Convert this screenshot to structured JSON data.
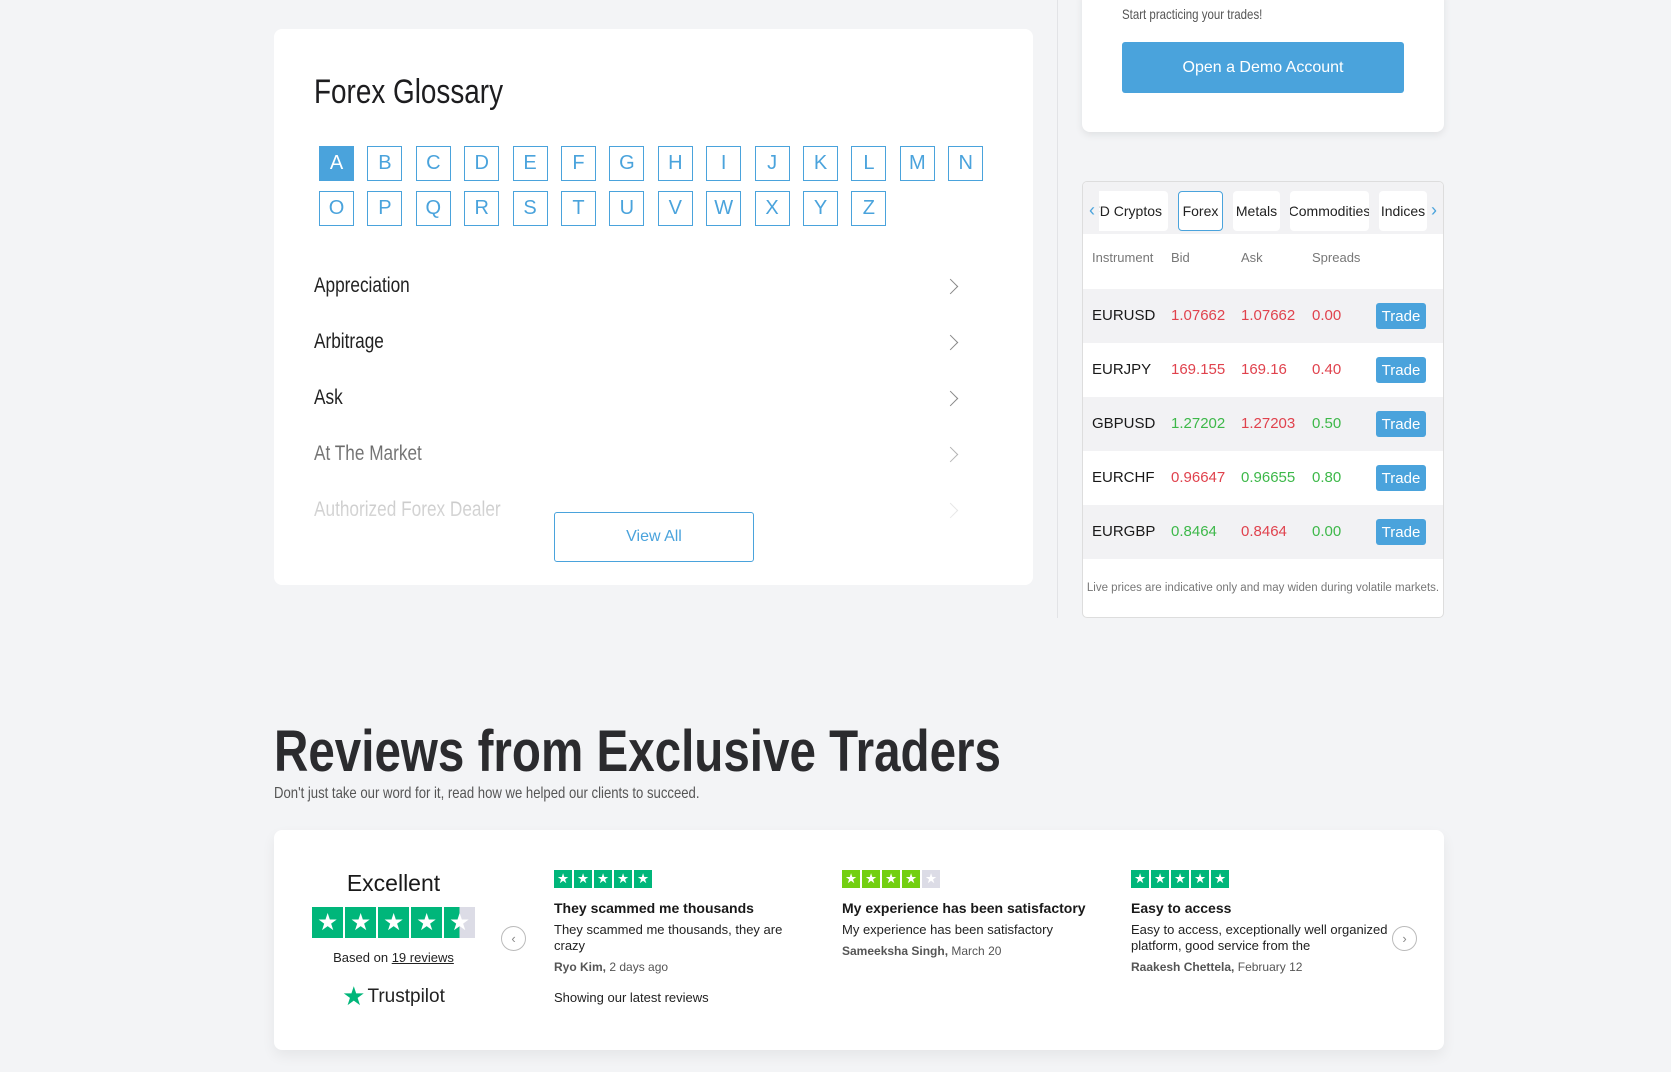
{
  "glossary": {
    "title": "Forex Glossary",
    "letters": [
      "A",
      "B",
      "C",
      "D",
      "E",
      "F",
      "G",
      "H",
      "I",
      "J",
      "K",
      "L",
      "M",
      "N",
      "O",
      "P",
      "Q",
      "R",
      "S",
      "T",
      "U",
      "V",
      "W",
      "X",
      "Y",
      "Z"
    ],
    "active_letter": "A",
    "terms": [
      "Appreciation",
      "Arbitrage",
      "Ask",
      "At The Market",
      "Authorized Forex Dealer"
    ],
    "view_all": "View All"
  },
  "demo": {
    "text": "Start practicing your trades!",
    "button": "Open a Demo Account"
  },
  "market": {
    "tabs": [
      "CFD Cryptos",
      "Forex",
      "Metals",
      "Commodities",
      "Indices"
    ],
    "active_tab": "Forex",
    "headers": [
      "Instrument",
      "Bid",
      "Ask",
      "Spreads"
    ],
    "rows": [
      {
        "instrument": "EURUSD",
        "bid": "1.07662",
        "ask": "1.07662",
        "spread": "0.00",
        "bid_color": "red",
        "ask_color": "red",
        "spread_color": "red"
      },
      {
        "instrument": "EURJPY",
        "bid": "169.155",
        "ask": "169.16",
        "spread": "0.40",
        "bid_color": "red",
        "ask_color": "red",
        "spread_color": "red"
      },
      {
        "instrument": "GBPUSD",
        "bid": "1.27202",
        "ask": "1.27203",
        "spread": "0.50",
        "bid_color": "green",
        "ask_color": "red",
        "spread_color": "green"
      },
      {
        "instrument": "EURCHF",
        "bid": "0.96647",
        "ask": "0.96655",
        "spread": "0.80",
        "bid_color": "red",
        "ask_color": "green",
        "spread_color": "green"
      },
      {
        "instrument": "EURGBP",
        "bid": "0.8464",
        "ask": "0.8464",
        "spread": "0.00",
        "bid_color": "green",
        "ask_color": "red",
        "spread_color": "green"
      }
    ],
    "trade_label": "Trade",
    "footer": "Live prices are indicative only and may widen during volatile markets."
  },
  "reviews": {
    "heading": "Reviews from Exclusive Traders",
    "subtitle": "Don't just take our word for it, read how we helped our clients to succeed.",
    "summary": {
      "rating_word": "Excellent",
      "stars": 4.5,
      "based_on": "Based on",
      "count_link": "19 reviews",
      "brand": "Trustpilot"
    },
    "items": [
      {
        "stars": 5,
        "title": "They scammed me thousands",
        "body": "They scammed me thousands, they are crazy",
        "author": "Ryo Kim,",
        "date": "2 days ago"
      },
      {
        "stars": 4,
        "title": "My experience has been satisfactory",
        "body": "My experience has been satisfactory",
        "author": "Sameeksha Singh,",
        "date": "March 20"
      },
      {
        "stars": 5,
        "title": "Easy to access",
        "body": "Easy to access, exceptionally well organized platform, good service from the",
        "author": "Raakesh Chettela,",
        "date": "February 12"
      }
    ],
    "showing": "Showing our latest reviews"
  },
  "colors": {
    "accent": "#4aa3dc",
    "red": "#e0424d",
    "green": "#3db849",
    "trustpilot": "#00b67a",
    "four_star": "#73cf11"
  }
}
